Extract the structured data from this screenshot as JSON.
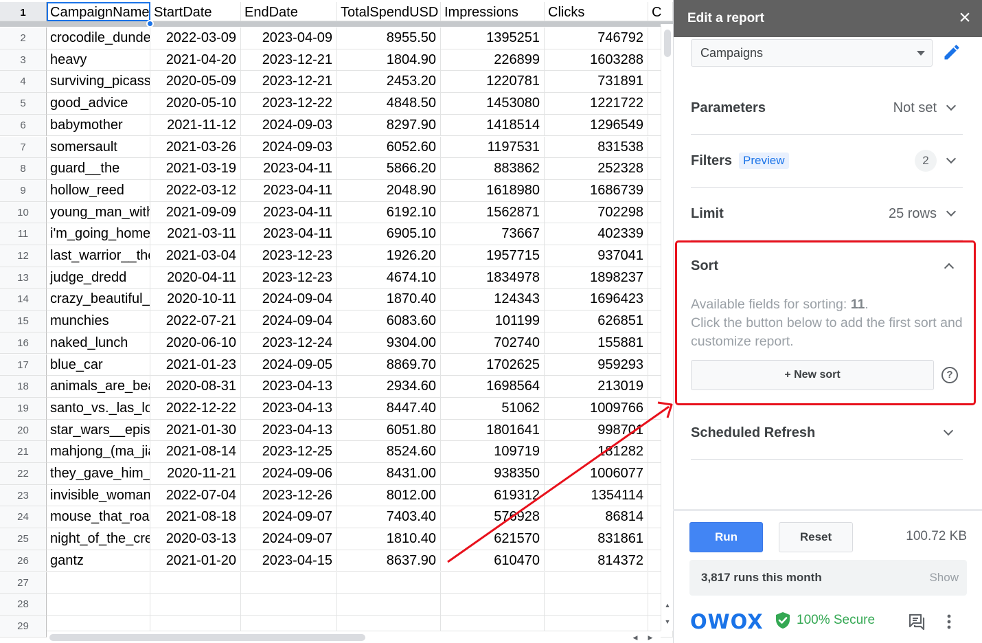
{
  "sheet": {
    "columns": [
      "CampaignName",
      "StartDate",
      "EndDate",
      "TotalSpendUSD",
      "Impressions",
      "Clicks",
      "C"
    ],
    "header_row_number": "1",
    "rows": [
      {
        "num": "2",
        "name": "crocodile_dunde",
        "start": "2022-03-09",
        "end": "2023-04-09",
        "spend": "8955.50",
        "impressions": "1395251",
        "clicks": "746792"
      },
      {
        "num": "3",
        "name": "heavy",
        "start": "2021-04-20",
        "end": "2023-12-21",
        "spend": "1804.90",
        "impressions": "226899",
        "clicks": "1603288"
      },
      {
        "num": "4",
        "name": "surviving_picass",
        "start": "2020-05-09",
        "end": "2023-12-21",
        "spend": "2453.20",
        "impressions": "1220781",
        "clicks": "731891"
      },
      {
        "num": "5",
        "name": "good_advice",
        "start": "2020-05-10",
        "end": "2023-12-22",
        "spend": "4848.50",
        "impressions": "1453080",
        "clicks": "1221722"
      },
      {
        "num": "6",
        "name": "babymother",
        "start": "2021-11-12",
        "end": "2024-09-03",
        "spend": "8297.90",
        "impressions": "1418514",
        "clicks": "1296549"
      },
      {
        "num": "7",
        "name": "somersault",
        "start": "2021-03-26",
        "end": "2024-09-03",
        "spend": "6052.60",
        "impressions": "1197531",
        "clicks": "831538"
      },
      {
        "num": "8",
        "name": "guard__the",
        "start": "2021-03-19",
        "end": "2023-04-11",
        "spend": "5866.20",
        "impressions": "883862",
        "clicks": "252328"
      },
      {
        "num": "9",
        "name": "hollow_reed",
        "start": "2022-03-12",
        "end": "2023-04-11",
        "spend": "2048.90",
        "impressions": "1618980",
        "clicks": "1686739"
      },
      {
        "num": "10",
        "name": "young_man_with",
        "start": "2021-09-09",
        "end": "2023-04-11",
        "spend": "6192.10",
        "impressions": "1562871",
        "clicks": "702298"
      },
      {
        "num": "11",
        "name": "i'm_going_home",
        "start": "2021-03-11",
        "end": "2023-04-11",
        "spend": "6905.10",
        "impressions": "73667",
        "clicks": "402339"
      },
      {
        "num": "12",
        "name": "last_warrior__the",
        "start": "2021-03-04",
        "end": "2023-12-23",
        "spend": "1926.20",
        "impressions": "1957715",
        "clicks": "937041"
      },
      {
        "num": "13",
        "name": "judge_dredd",
        "start": "2020-04-11",
        "end": "2023-12-23",
        "spend": "4674.10",
        "impressions": "1834978",
        "clicks": "1898237"
      },
      {
        "num": "14",
        "name": "crazy_beautiful_",
        "start": "2020-10-11",
        "end": "2024-09-04",
        "spend": "1870.40",
        "impressions": "124343",
        "clicks": "1696423"
      },
      {
        "num": "15",
        "name": "munchies",
        "start": "2022-07-21",
        "end": "2024-09-04",
        "spend": "6083.60",
        "impressions": "101199",
        "clicks": "626851"
      },
      {
        "num": "16",
        "name": "naked_lunch",
        "start": "2020-06-10",
        "end": "2023-12-24",
        "spend": "9304.00",
        "impressions": "702740",
        "clicks": "155881"
      },
      {
        "num": "17",
        "name": "blue_car",
        "start": "2021-01-23",
        "end": "2024-09-05",
        "spend": "8869.70",
        "impressions": "1702625",
        "clicks": "959293"
      },
      {
        "num": "18",
        "name": "animals_are_bea",
        "start": "2020-08-31",
        "end": "2023-04-13",
        "spend": "2934.60",
        "impressions": "1698564",
        "clicks": "213019"
      },
      {
        "num": "19",
        "name": "santo_vs._las_lo",
        "start": "2022-12-22",
        "end": "2023-04-13",
        "spend": "8447.40",
        "impressions": "51062",
        "clicks": "1009766"
      },
      {
        "num": "20",
        "name": "star_wars__epis",
        "start": "2021-01-30",
        "end": "2023-04-13",
        "spend": "6051.80",
        "impressions": "1801641",
        "clicks": "998701"
      },
      {
        "num": "21",
        "name": "mahjong_(ma_jia",
        "start": "2021-08-14",
        "end": "2023-12-25",
        "spend": "8524.60",
        "impressions": "109719",
        "clicks": "181282"
      },
      {
        "num": "22",
        "name": "they_gave_him_",
        "start": "2020-11-21",
        "end": "2024-09-06",
        "spend": "8431.00",
        "impressions": "938350",
        "clicks": "1006077"
      },
      {
        "num": "23",
        "name": "invisible_woman",
        "start": "2022-07-04",
        "end": "2023-12-26",
        "spend": "8012.00",
        "impressions": "619312",
        "clicks": "1354114"
      },
      {
        "num": "24",
        "name": "mouse_that_roar",
        "start": "2021-08-18",
        "end": "2024-09-07",
        "spend": "7403.40",
        "impressions": "576928",
        "clicks": "86814"
      },
      {
        "num": "25",
        "name": "night_of_the_cre",
        "start": "2020-03-13",
        "end": "2024-09-07",
        "spend": "1810.40",
        "impressions": "621570",
        "clicks": "831861"
      },
      {
        "num": "26",
        "name": "gantz",
        "start": "2021-01-20",
        "end": "2023-04-15",
        "spend": "8637.90",
        "impressions": "610470",
        "clicks": "814372"
      },
      {
        "num": "27",
        "name": "",
        "start": "",
        "end": "",
        "spend": "",
        "impressions": "",
        "clicks": ""
      },
      {
        "num": "28",
        "name": "",
        "start": "",
        "end": "",
        "spend": "",
        "impressions": "",
        "clicks": ""
      },
      {
        "num": "29",
        "name": "",
        "start": "",
        "end": "",
        "spend": "",
        "impressions": "",
        "clicks": ""
      }
    ]
  },
  "panel": {
    "title": "Edit a report",
    "report_select": "Campaigns",
    "parameters": {
      "label": "Parameters",
      "value": "Not set"
    },
    "filters": {
      "label": "Filters",
      "badge": "Preview",
      "count": "2"
    },
    "limit": {
      "label": "Limit",
      "value": "25 rows"
    },
    "sort": {
      "label": "Sort",
      "desc_prefix": "Available fields for sorting: ",
      "field_count": "11",
      "desc_suffix": ".",
      "desc_line2": "Click the button below to add the first sort and customize report.",
      "new_sort_label": "+ New sort",
      "help_symbol": "?"
    },
    "scheduled_refresh": {
      "label": "Scheduled Refresh"
    },
    "run_label": "Run",
    "reset_label": "Reset",
    "size_label": "100.72 KB",
    "runs_text": "3,817 runs this month",
    "show_label": "Show",
    "brand": "OWOX",
    "secure_text": "100% Secure"
  },
  "colors": {
    "accent": "#1a73e8",
    "run_button": "#4285f4",
    "highlight": "#e8111c",
    "header_bar": "#616161",
    "secure_green": "#34a853"
  },
  "icons": [
    "close-icon",
    "dropdown-caret-icon",
    "pencil-icon",
    "chevron-down-icon",
    "chevron-up-icon",
    "help-icon",
    "shield-check-icon",
    "chat-icon",
    "more-vert-icon"
  ]
}
